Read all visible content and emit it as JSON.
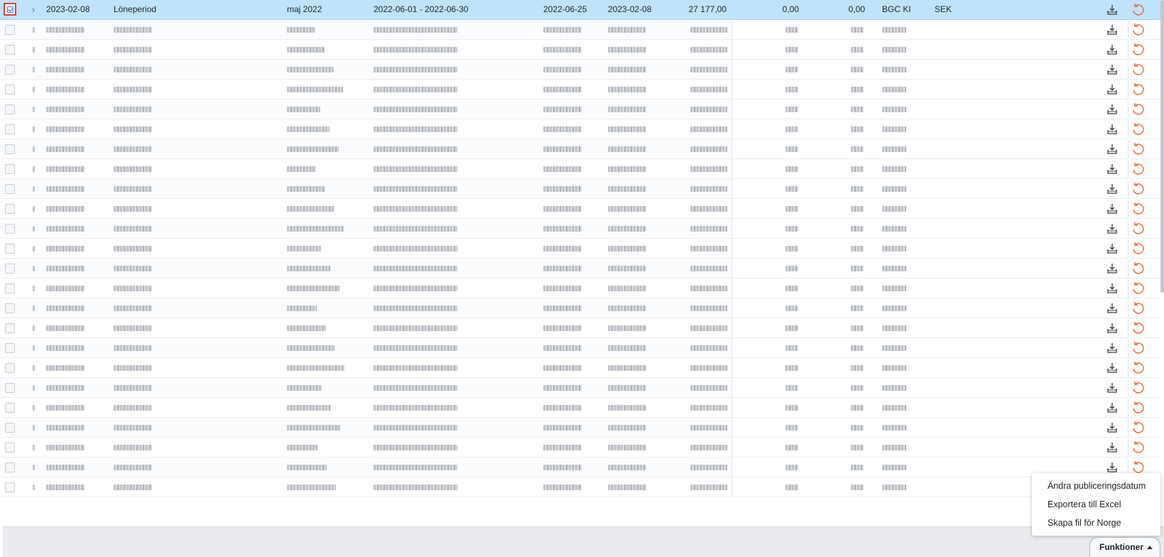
{
  "selected_row": {
    "date": "2023-02-08",
    "type": "Löneperiod",
    "period_name": "maj 2022",
    "period_range": "2022-06-01 - 2022-06-30",
    "payment_date": "2022-06-25",
    "published_date": "2023-02-08",
    "amount": "27 177,00",
    "value_a": "0,00",
    "value_b": "0,00",
    "method": "BGC KI",
    "currency": "SEK"
  },
  "blurred_row_count": 24,
  "icons": {
    "download": "download-tray-icon",
    "undo": "undo-arrow-icon",
    "expand": "chevron-right-icon",
    "caret": "caret-up-icon"
  },
  "colors": {
    "selected_row_bg": "#bfe3fb",
    "checkbox_highlight": "#e43b3b",
    "undo_icon": "#e8663d"
  },
  "functions_menu": {
    "button_label": "Funktioner",
    "items": [
      "Ändra publiceringsdatum",
      "Exportera till Excel",
      "Skapa fil för Norge"
    ]
  }
}
